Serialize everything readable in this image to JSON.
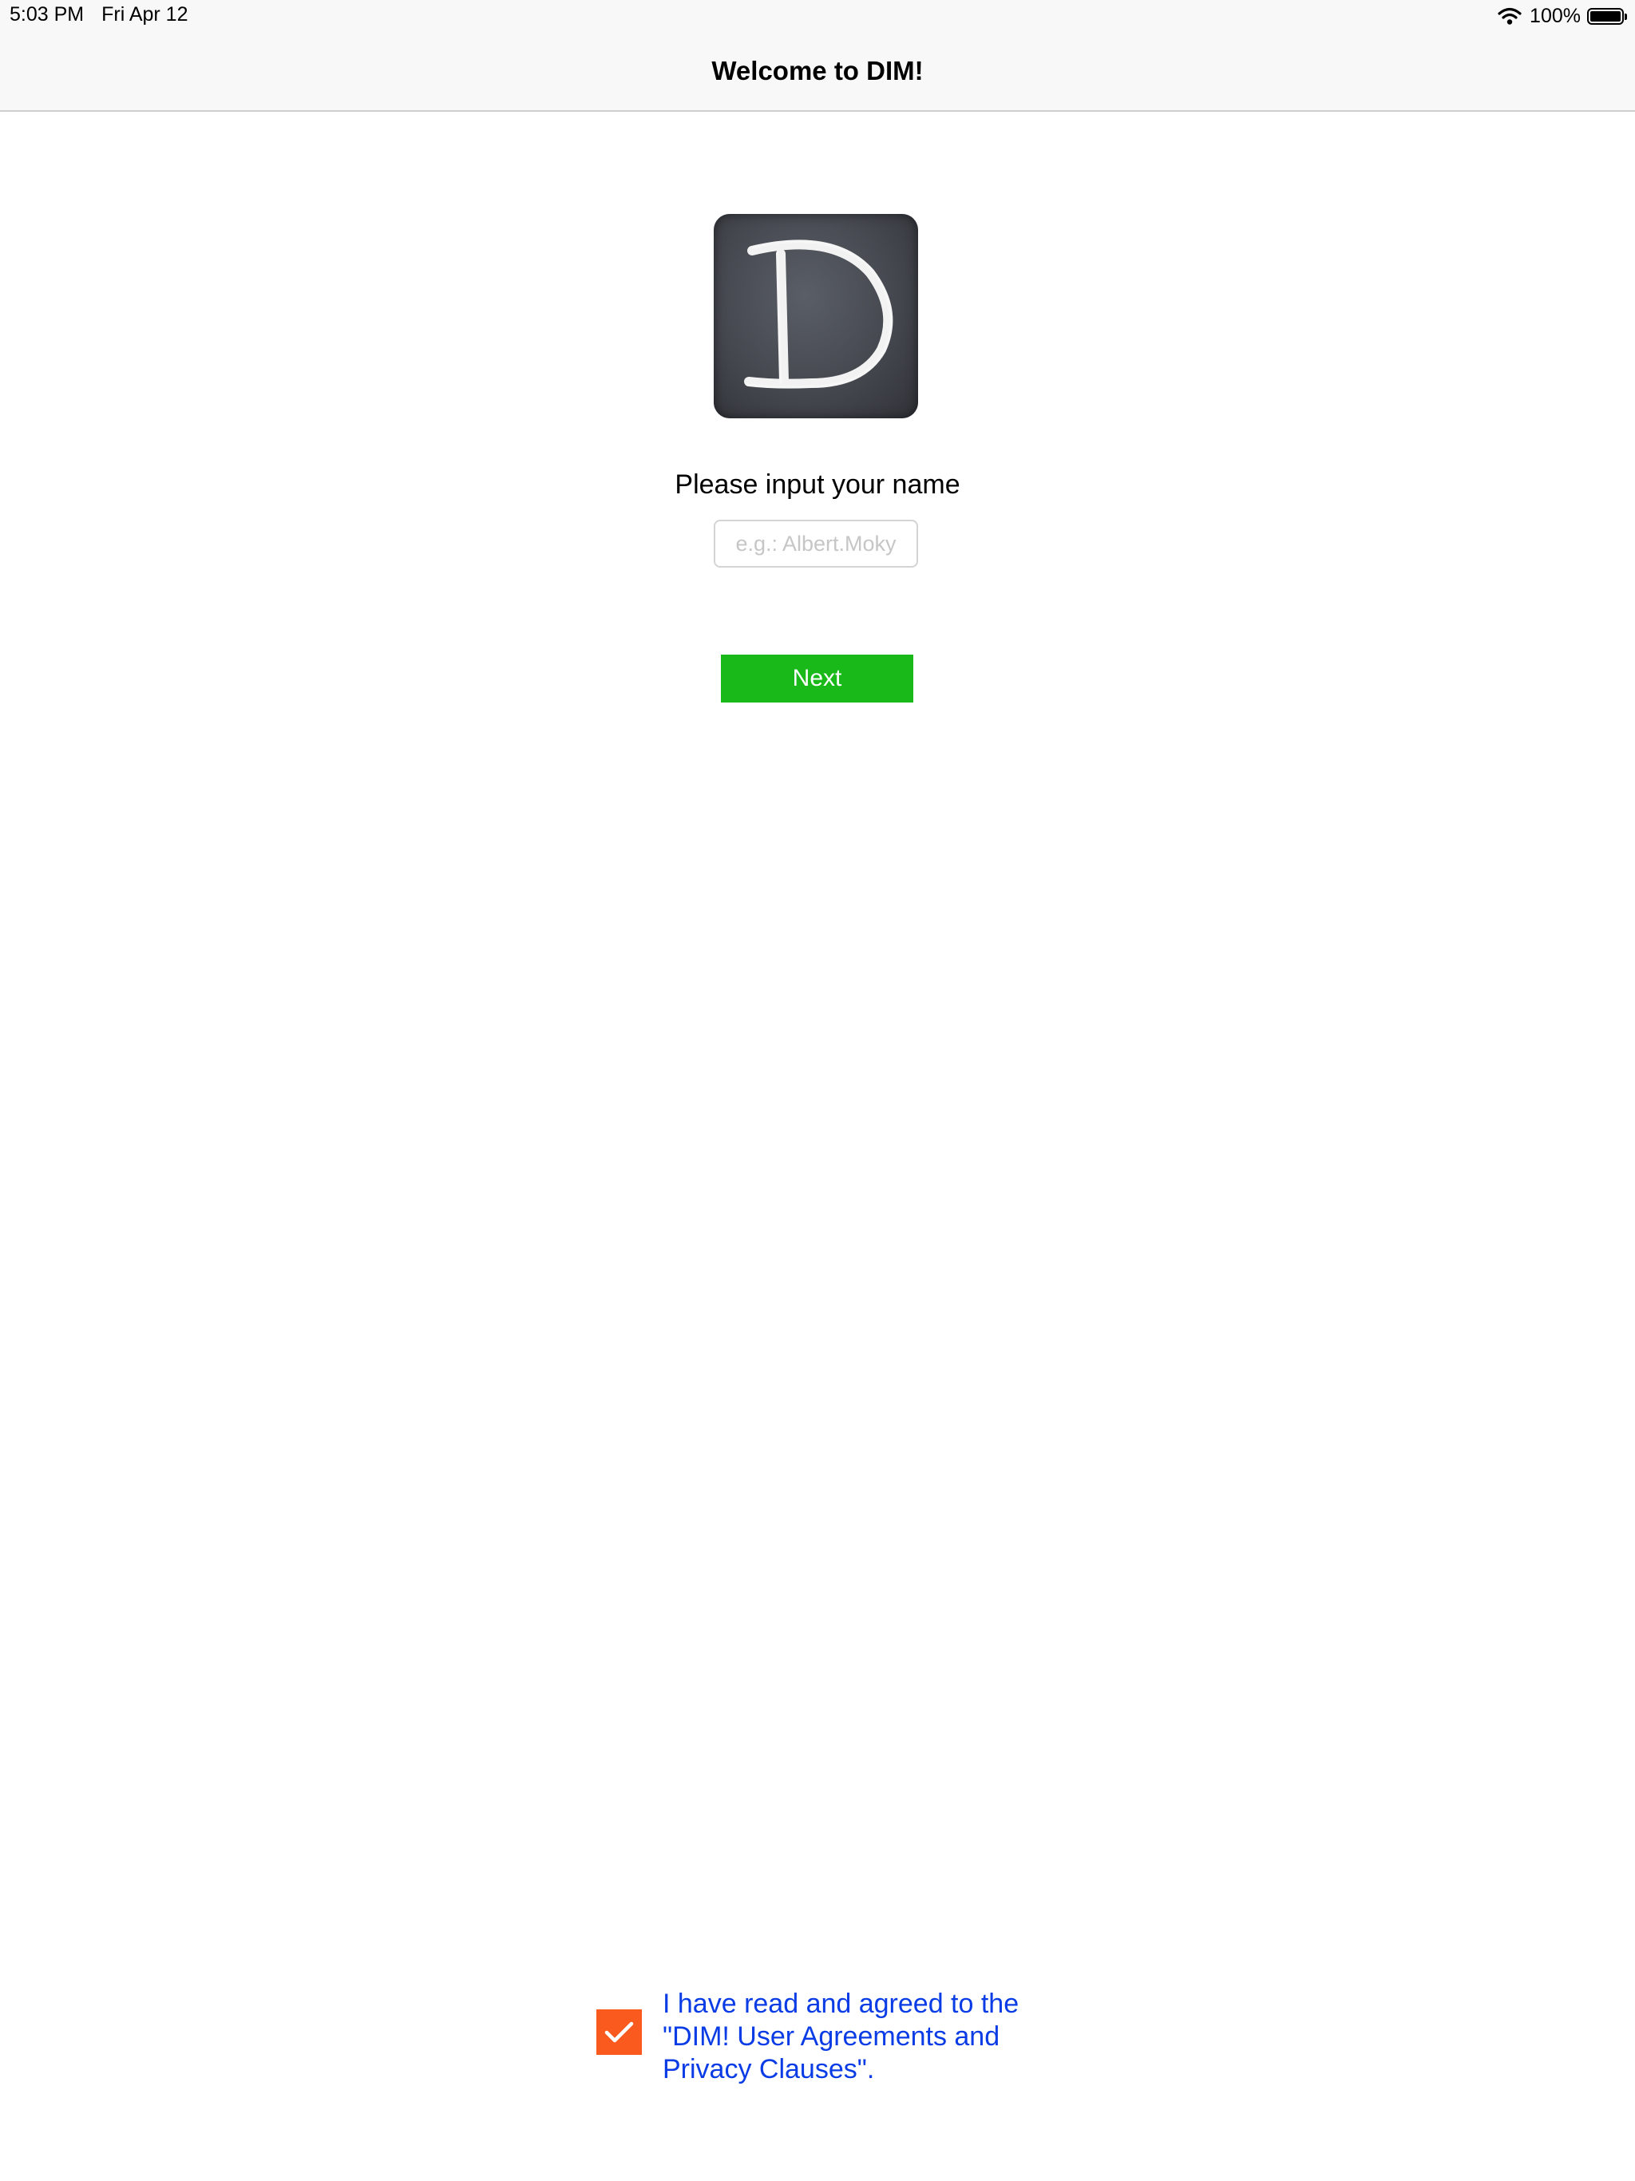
{
  "status_bar": {
    "time": "5:03 PM",
    "date": "Fri Apr 12",
    "battery_percent": "100%",
    "battery_level": 1.0,
    "wifi_icon": "wifi-icon",
    "battery_icon": "battery-icon"
  },
  "nav": {
    "title": "Welcome to DIM!"
  },
  "logo": {
    "icon": "chalkboard-d-logo",
    "letter": "D"
  },
  "form": {
    "prompt": "Please input your name",
    "name_placeholder": "e.g.: Albert.Moky",
    "name_value": "",
    "next_label": "Next"
  },
  "agreement": {
    "checked": true,
    "checkbox_icon": "checkmark-icon",
    "text": "I have read and agreed to the \"DIM! User Agreements and Privacy Clauses\"."
  },
  "colors": {
    "next_button": "#1ab91a",
    "checkbox": "#fa5a1e",
    "link": "#0a3ce6",
    "nav_background": "#f8f8f8"
  }
}
